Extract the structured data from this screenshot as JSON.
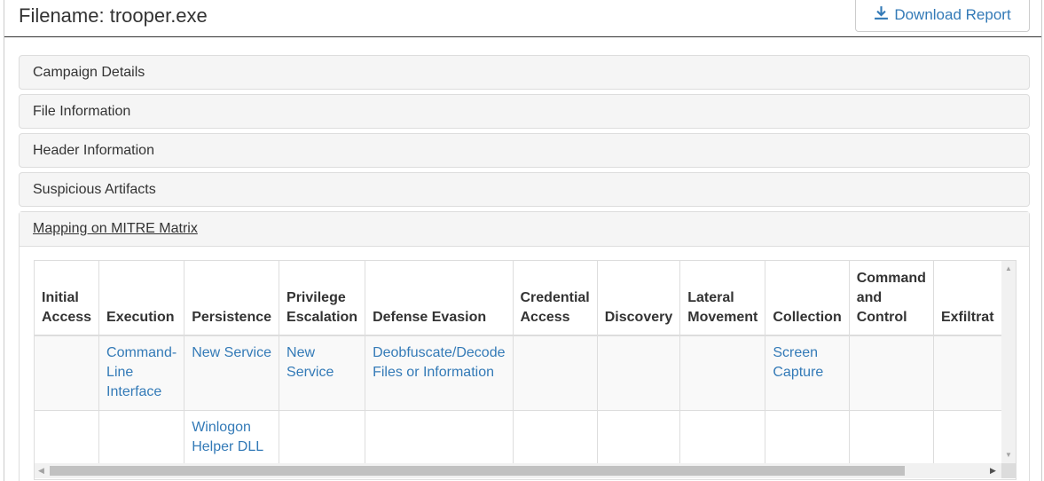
{
  "header": {
    "title": "Filename: trooper.exe",
    "download_label": "Download Report",
    "download_icon": "download-icon"
  },
  "panels": [
    {
      "label": "Campaign Details"
    },
    {
      "label": "File Information"
    },
    {
      "label": "Header Information"
    },
    {
      "label": "Suspicious Artifacts"
    },
    {
      "label": "Mapping on MITRE Matrix"
    }
  ],
  "matrix": {
    "columns": [
      "Initial Access",
      "Execution",
      "Persistence",
      "Privilege Escalation",
      "Defense Evasion",
      "Credential Access",
      "Discovery",
      "Lateral Movement",
      "Collection",
      "Command and Control",
      "Exfiltrat"
    ],
    "rows": [
      [
        "",
        "Command-Line Interface",
        "New Service",
        "New Service",
        "Deobfuscate/Decode Files or Information",
        "",
        "",
        "",
        "Screen Capture",
        "",
        ""
      ],
      [
        "",
        "",
        "Winlogon Helper DLL",
        "",
        "",
        "",
        "",
        "",
        "",
        "",
        ""
      ]
    ]
  },
  "colors": {
    "link": "#337ab7",
    "panel_bg": "#f5f5f5",
    "border": "#dddddd"
  }
}
